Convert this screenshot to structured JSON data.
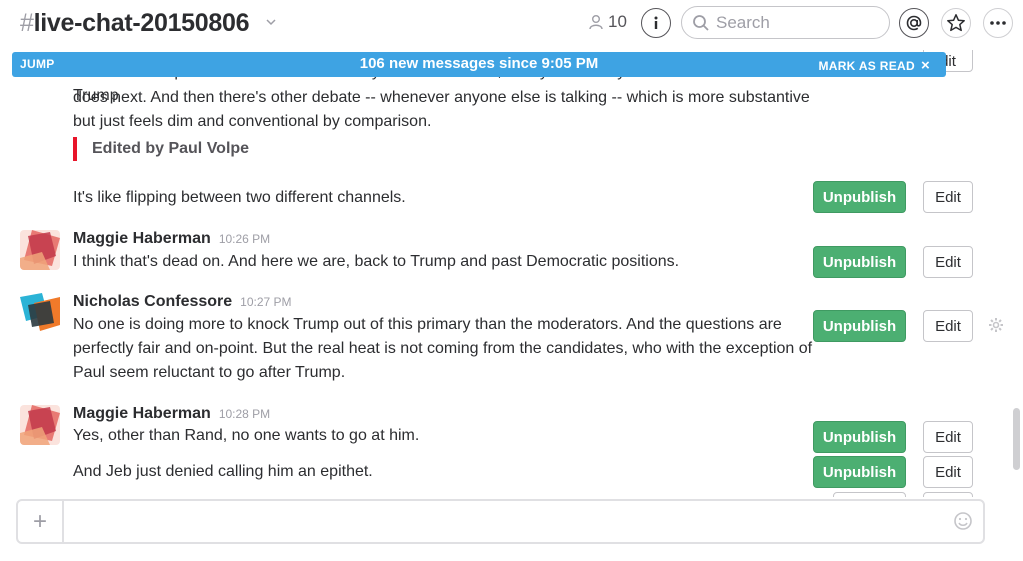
{
  "header": {
    "hash": "#",
    "channel_name": "live-chat-20150806",
    "member_count": "10",
    "search_placeholder": "Search"
  },
  "banner": {
    "jump_label": "JUMP",
    "new_messages": "106 new messages since 9:05 PM",
    "mark_read_label": "MARK AS READ",
    "close_glyph": "×",
    "color": "#3ea3e3"
  },
  "messages": {
    "partial_top": "between Trump and the Fox hosts -- showy and must-watch, if only because you want to see what Trump",
    "partial_rest": "does next. And then there's other debate -- whenever anyone else is talking -- which is more substantive but just feels dim and conventional by comparison.",
    "edited_note": "Edited by Paul Volpe",
    "m1_text": "It's like flipping between two different channels.",
    "m2_author": "Maggie Haberman",
    "m2_time": "10:26 PM",
    "m2_text": "I think that's dead on. And here we are, back to Trump and past Democratic positions.",
    "m3_author": "Nicholas Confessore",
    "m3_time": "10:27 PM",
    "m3_text": "No one is doing more to knock Trump out of this primary than the moderators. And the questions are perfectly fair and on-point. But the real heat is not coming from the candidates, who with the exception of Paul seem reluctant to go after Trump.",
    "m4_author": "Maggie Haberman",
    "m4_time": "10:28 PM",
    "m4_text": "Yes, other than Rand, no one wants to go at him.",
    "m5_text": "And Jeb just denied calling him an epithet."
  },
  "actions": {
    "unpublish_label": "Unpublish",
    "edit_label": "Edit",
    "edit_partial_label": "dit",
    "unpublish_color": "#4caf72"
  },
  "composer": {
    "plus_glyph": "+",
    "placeholder": ""
  },
  "icons": {
    "members": "person-icon",
    "info": "info-icon",
    "search": "search-icon",
    "mentions": "at-sign-icon",
    "star": "star-icon",
    "more": "more-icon",
    "gear": "gear-icon",
    "emoji": "emoji-icon"
  }
}
